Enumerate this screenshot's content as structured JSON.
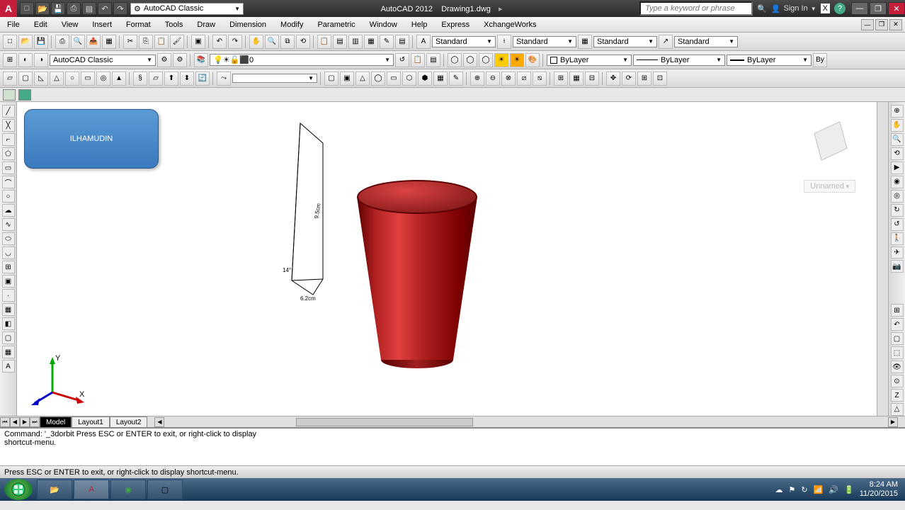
{
  "titlebar": {
    "workspace": "AutoCAD Classic",
    "product": "AutoCAD 2012",
    "filename": "Drawing1.dwg",
    "search_placeholder": "Type a keyword or phrase",
    "signin": "Sign In"
  },
  "menus": [
    "File",
    "Edit",
    "View",
    "Insert",
    "Format",
    "Tools",
    "Draw",
    "Dimension",
    "Modify",
    "Parametric",
    "Window",
    "Help",
    "Express",
    "XchangeWorks"
  ],
  "styles_row": {
    "workspace2": "AutoCAD Classic",
    "text_style": "Standard",
    "dim_style": "Standard",
    "table_style": "Standard",
    "mleader_style": "Standard",
    "layer": "0",
    "color": "ByLayer",
    "linetype": "ByLayer",
    "lineweight": "ByLayer"
  },
  "badge": "ILHAMUDIN",
  "view_label": "Unnamed",
  "tabs": [
    "Model",
    "Layout1",
    "Layout2"
  ],
  "active_tab": 0,
  "command": {
    "line1": "Command: '_3dorbit Press ESC or ENTER to exit, or right-click to display",
    "line2": "shortcut-menu."
  },
  "statusbar_hint": "Press ESC or ENTER to exit, or right-click to display shortcut-menu.",
  "clock": {
    "time": "8:24 AM",
    "date": "11/20/2015"
  },
  "qat_icons": [
    "new",
    "open",
    "save",
    "print-preview",
    "print",
    "undo",
    "redo"
  ],
  "tb1_icons": [
    "new",
    "open",
    "save",
    "saveas",
    "print",
    "preview",
    "publish",
    "cut",
    "copy",
    "paste",
    "match",
    "undo",
    "redo",
    "properties"
  ],
  "tb2_icons": [
    "pan",
    "zoom-win",
    "zoom-prev",
    "zoom-rt"
  ],
  "tb3_icons": [
    "box",
    "wedge",
    "cone",
    "sphere",
    "cylinder",
    "torus",
    "pyramid",
    "helix",
    "polysolid",
    "planar",
    "extrude",
    "revolve",
    "loft",
    "sweep",
    "presspull",
    "union",
    "subtract",
    "intersect",
    "slice",
    "thicken",
    "imprint",
    "fillet-edge",
    "chamfer-edge",
    "shell"
  ],
  "left_tools": [
    "line",
    "pline",
    "circle",
    "arc",
    "rect",
    "ellipse",
    "hatch",
    "spline",
    "point",
    "text",
    "mtext",
    "dim",
    "region",
    "table",
    "block"
  ],
  "right_tools": [
    "nav",
    "pan",
    "orbit",
    "zoom",
    "steering",
    "showmotion",
    "sectionplane",
    "flatshot",
    "3dalign",
    "3dmove",
    "3drotate",
    "3dscale"
  ]
}
